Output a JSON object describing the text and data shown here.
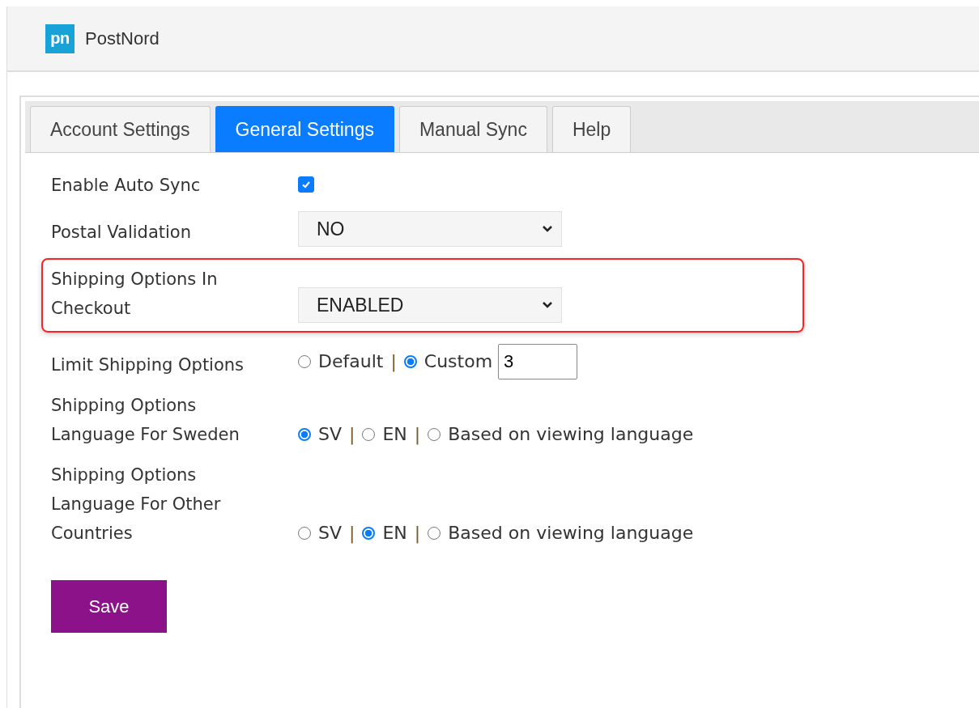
{
  "header": {
    "logo_text": "pn",
    "brand": "PostNord"
  },
  "tabs": [
    {
      "label": "Account Settings",
      "selected": false
    },
    {
      "label": "General Settings",
      "selected": true
    },
    {
      "label": "Manual Sync",
      "selected": false
    },
    {
      "label": "Help",
      "selected": false
    }
  ],
  "settings": [
    {
      "kind": "checkbox",
      "label": "Enable Auto Sync",
      "checked": true,
      "highlighted": false
    },
    {
      "kind": "select",
      "label": "Postal Validation",
      "value": "NO",
      "highlighted": false
    },
    {
      "kind": "select",
      "label": "Shipping Options In Checkout",
      "value": "ENABLED",
      "highlighted": true
    },
    {
      "kind": "radio",
      "label": "Limit Shipping Options",
      "separator": "|",
      "highlighted": false,
      "options": [
        {
          "label": "Default",
          "selected": false
        },
        {
          "label": "Custom",
          "selected": true,
          "value": "3"
        }
      ]
    },
    {
      "kind": "radio",
      "label": "Shipping Options Language For Sweden",
      "separator": "|",
      "highlighted": false,
      "options": [
        {
          "label": "SV",
          "selected": true
        },
        {
          "label": "EN",
          "selected": false
        },
        {
          "label": "Based on viewing language",
          "selected": false
        }
      ]
    },
    {
      "kind": "radio",
      "label": "Shipping Options Language For Other Countries",
      "separator": "|",
      "highlighted": false,
      "options": [
        {
          "label": "SV",
          "selected": false
        },
        {
          "label": "EN",
          "selected": true
        },
        {
          "label": "Based on viewing language",
          "selected": false
        }
      ]
    }
  ],
  "save_button": "Save"
}
